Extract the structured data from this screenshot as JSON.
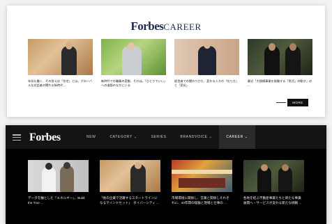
{
  "top": {
    "brand_forbes": "Forbes",
    "brand_career": "CAREER",
    "articles": [
      {
        "caption": "年収も働く、その答えは「住宅」とは。グローバルな対話者の関わる新時代 ..."
      },
      {
        "caption": "新時代での職業の変動、それは。「ひとりでいい」への道筋のなかにいる"
      },
      {
        "caption": "経営者での関わりかた、変わる人々の「在り方」と「変化」"
      },
      {
        "caption": "最近「大規模事業を経験する「常活」の動き」の ..."
      }
    ],
    "more_label": "MORE"
  },
  "nav": {
    "logo": "Forbes",
    "items": [
      {
        "label": "NEW"
      },
      {
        "label": "CATEGORY ⌄"
      },
      {
        "label": "SERIES"
      },
      {
        "label": "BRANDVOICE ⌄"
      },
      {
        "label": "CAREER ⌄"
      }
    ]
  },
  "bottom": {
    "articles": [
      {
        "caption": "データを軸とした「エネルギー」、Build the True ..."
      },
      {
        "caption": "「他の企業で活躍するスタートラインになるマインドセット」　ダイバーシティ ..."
      },
      {
        "caption": "市場環境に関係し、営業と関係しそれぞれに、40年間の経験と現場と仕事の ..."
      },
      {
        "caption": "各地を結ぶ不動産事業たちと新たな事業展開へ・サービスが変わる新たな挑戦 ..."
      }
    ]
  }
}
